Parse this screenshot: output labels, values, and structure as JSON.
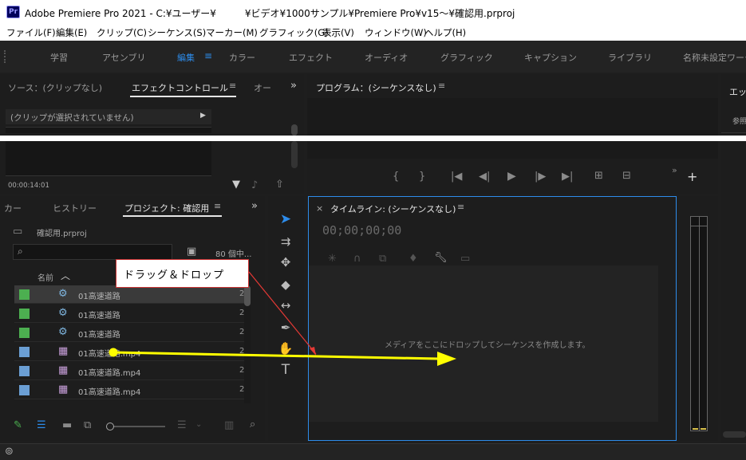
{
  "title_bar": {
    "app_icon": "Pr",
    "title": "Adobe Premiere Pro 2021 - C:¥ユーザー¥　　　¥ビデオ¥1000サンプル¥Premiere Pro¥v15〜¥確認用.prproj"
  },
  "menu": [
    "ファイル(F)",
    "編集(E)",
    "クリップ(C)",
    "シーケンス(S)",
    "マーカー(M)",
    "グラフィック(G)",
    "表示(V)",
    "ウィンドウ(W)",
    "ヘルプ(H)"
  ],
  "workspaces": [
    "学習",
    "アセンブリ",
    "編集",
    "カラー",
    "エフェクト",
    "オーディオ",
    "グラフィック",
    "キャプション",
    "ライブラリ",
    "名称未設定ワーク"
  ],
  "source_panel": {
    "tab_source": "ソース：(クリップなし)",
    "tab_effect_controls": "エフェクトコントロール",
    "tab_more": "オー",
    "no_clip": "(クリップが選択されていません)",
    "timecode": "00:00:14:01"
  },
  "program_panel": {
    "title": "プログラム：(シーケンスなし)"
  },
  "right_panel": {
    "title": "エッ",
    "sub": "参照"
  },
  "project_panel": {
    "tab_markers": "カー",
    "tab_history": "ヒストリー",
    "tab_project": "プロジェクト: 確認用",
    "project_file": "確認用.prproj",
    "item_count": "80 個中...",
    "column_name": "名前",
    "items": [
      {
        "name": "01高速道路",
        "type": "sequence",
        "color": "#4caf50",
        "rate": "2"
      },
      {
        "name": "01高速道路",
        "type": "sequence",
        "color": "#4caf50",
        "rate": "2"
      },
      {
        "name": "01高速道路",
        "type": "sequence",
        "color": "#4caf50",
        "rate": "2"
      },
      {
        "name": "01高速道路.mp4",
        "type": "video",
        "color": "#6b9fd4",
        "rate": "2"
      },
      {
        "name": "01高速道路.mp4",
        "type": "video",
        "color": "#6b9fd4",
        "rate": "2"
      },
      {
        "name": "01高速道路.mp4",
        "type": "video",
        "color": "#6b9fd4",
        "rate": "2"
      }
    ]
  },
  "timeline_panel": {
    "title": "タイムライン: (シーケンスなし)",
    "timecode": "00;00;00;00",
    "drop_hint": "メディアをここにドロップしてシーケンスを作成します。"
  },
  "annotation": {
    "label": "ドラッグ＆ドロップ",
    "arrow_color": "#ffff00",
    "line_color": "#e53935"
  },
  "colors": {
    "accent": "#2d8ceb",
    "panel_bg": "#1d1d1d"
  }
}
